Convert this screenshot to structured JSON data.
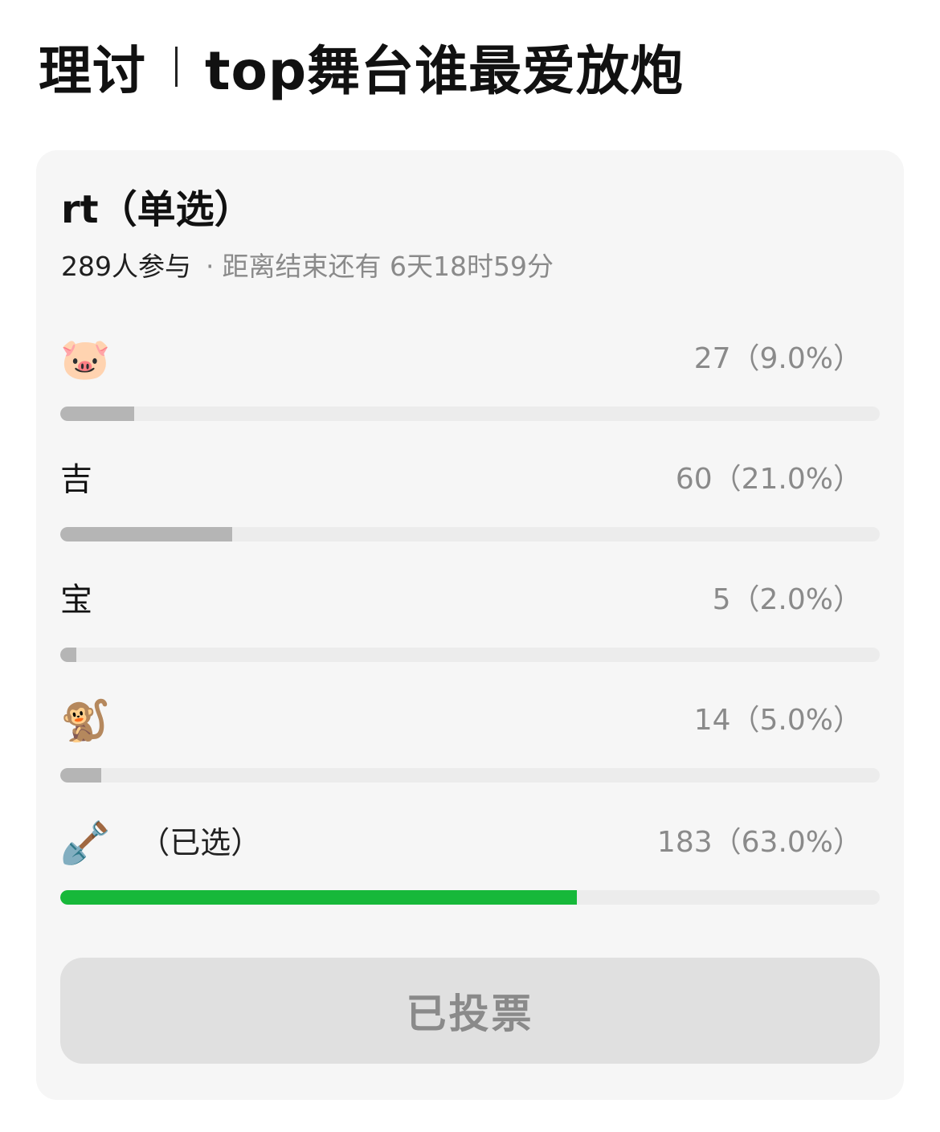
{
  "header": {
    "category": "理讨",
    "title": "top舞台谁最爱放炮"
  },
  "poll": {
    "question": "rt（单选）",
    "participants": "289人参与",
    "separator": "·",
    "deadline": "距离结束还有 6天18时59分",
    "options": [
      {
        "emoji": "🐷",
        "label": "",
        "count": "27（9.0%）",
        "fraction": 0.09,
        "selected": false
      },
      {
        "emoji": "",
        "label": "吉",
        "count": "60（21.0%）",
        "fraction": 0.21,
        "selected": false
      },
      {
        "emoji": "",
        "label": "宝",
        "count": "5（2.0%）",
        "fraction": 0.02,
        "selected": false
      },
      {
        "emoji": "🐒",
        "label": "",
        "count": "14（5.0%）",
        "fraction": 0.05,
        "selected": false
      },
      {
        "emoji": "🪏",
        "label": "",
        "selected_tag": "（已选）",
        "count": "183（63.0%）",
        "fraction": 0.63,
        "selected": true
      }
    ],
    "vote_button_label": "已投票"
  },
  "colors": {
    "selected_bar": "#17b83a",
    "unselected_bar": "#b5b5b5",
    "track": "#ececec",
    "card_background": "#f6f6f6"
  }
}
